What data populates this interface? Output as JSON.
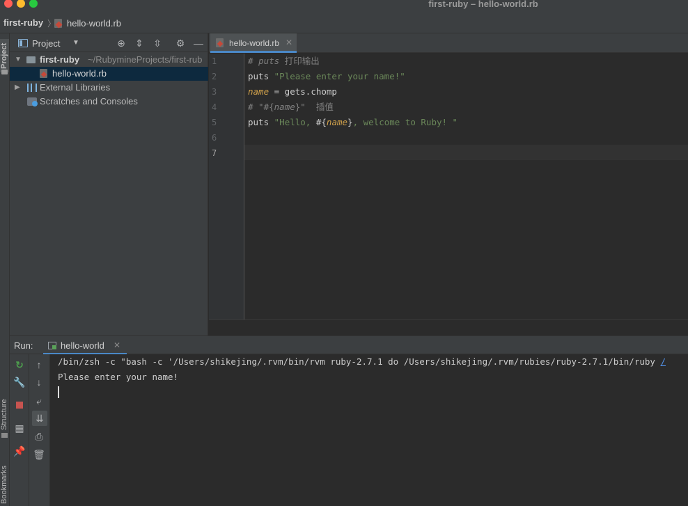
{
  "window": {
    "title": "first-ruby – hello-world.rb"
  },
  "breadcrumb": {
    "project": "first-ruby",
    "separator": "〉",
    "file": "hello-world.rb"
  },
  "left_strip": {
    "project_tab": "Project",
    "structure_tab": "Structure",
    "bookmarks_tab": "Bookmarks"
  },
  "project_panel": {
    "title": "Project",
    "tree": [
      {
        "label": "first-ruby",
        "path": "~/RubymineProjects/first-rub",
        "type": "folder",
        "expanded": true
      },
      {
        "label": "hello-world.rb",
        "type": "ruby-file",
        "selected": true
      },
      {
        "label": "External Libraries",
        "type": "library",
        "expanded": false
      },
      {
        "label": "Scratches and Consoles",
        "type": "scratch"
      }
    ]
  },
  "editor": {
    "tab_label": "hello-world.rb",
    "current_line": 7,
    "line_numbers": [
      "1",
      "2",
      "3",
      "4",
      "5",
      "6",
      "7"
    ],
    "lines": [
      {
        "comment_prefix": "# ",
        "comment_italic": "puts",
        "comment_rest": " 打印输出"
      },
      {
        "kw": "puts ",
        "str": "\"Please enter your name!\""
      },
      {
        "var": "name",
        "rest": " = gets.chomp"
      },
      {
        "comment_prefix": "# \"#{",
        "comment_italic": "name",
        "comment_rest": "}\"  插值"
      },
      {
        "kw": "puts ",
        "str_start": "\"Hello, ",
        "interp_open": "#{",
        "var": "name",
        "interp_close": "}",
        "str_end": ", welcome to Ruby! \""
      },
      {
        "text": ""
      },
      {
        "text": ""
      }
    ]
  },
  "run_panel": {
    "label": "Run:",
    "tab_label": "hello-world",
    "console": {
      "command": "/bin/zsh -c \"bash -c '/Users/shikejing/.rvm/bin/rvm ruby-2.7.1 do /Users/shikejing/.rvm/rubies/ruby-2.7.1/bin/ruby ",
      "command_link": "/",
      "output": "Please enter your name!"
    }
  },
  "colors": {
    "accent": "#4a88c7",
    "string": "#6a8759",
    "variable": "#d0a14b",
    "comment": "#808080",
    "selection": "#0d293e"
  }
}
